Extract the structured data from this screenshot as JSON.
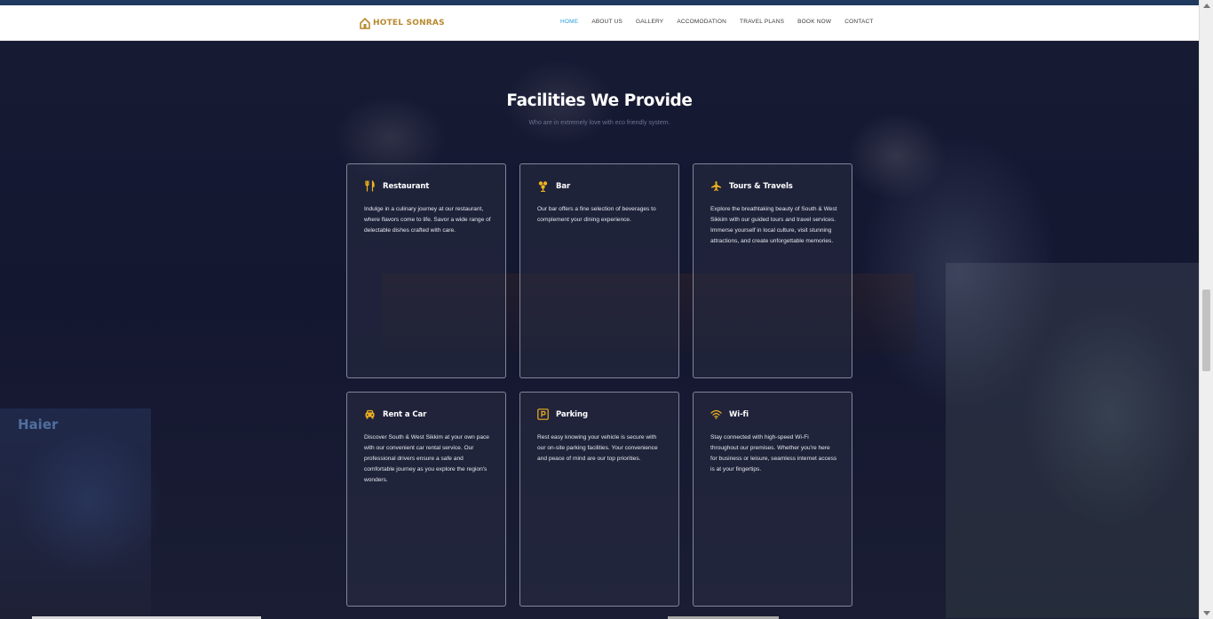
{
  "navbar": {
    "logo_text": "HOTEL SONRAS",
    "menu": [
      {
        "label": "HOME",
        "active": true
      },
      {
        "label": "ABOUT US",
        "active": false
      },
      {
        "label": "GALLERY",
        "active": false
      },
      {
        "label": "ACCOMODATION",
        "active": false
      },
      {
        "label": "TRAVEL PLANS",
        "active": false
      },
      {
        "label": "BOOK NOW",
        "active": false
      },
      {
        "label": "CONTACT",
        "active": false
      }
    ]
  },
  "section": {
    "title": "Facilities We Provide",
    "subtitle": "Who are in extremely love with eco friendly system.",
    "background_text": "Haier"
  },
  "facilities": [
    {
      "icon": "utensils-icon",
      "title": "Restaurant",
      "text": "Indulge in a culinary journey at our restaurant, where flavors come to life. Savor a wide range of delectable dishes crafted with care."
    },
    {
      "icon": "cocktail-icon",
      "title": "Bar",
      "text": "Our bar offers a fine selection of beverages to complement your dining experience."
    },
    {
      "icon": "airplane-icon",
      "title": "Tours & Travels",
      "text": "Explore the breathtaking beauty of South & West Sikkim with our guided tours and travel services. Immerse yourself in local culture, visit stunning attractions, and create unforgettable memories."
    },
    {
      "icon": "car-icon",
      "title": "Rent a Car",
      "text": "Discover South & West Sikkim at your own pace with our convenient car rental service. Our professional drivers ensure a safe and comfortable journey as you explore the region's wonders."
    },
    {
      "icon": "parking-icon",
      "title": "Parking",
      "text": "Rest easy knowing your vehicle is secure with our on-site parking facilities. Your convenience and peace of mind are our top priorities."
    },
    {
      "icon": "wifi-icon",
      "title": "Wi-fi",
      "text": "Stay connected with high-speed Wi-Fi throughout our premises. Whether you're here for business or leisure, seamless internet access is at your fingertips."
    }
  ],
  "colors": {
    "accent": "#f0b21e",
    "nav_active": "#2a9ee0",
    "logo": "#b8892f",
    "background": "#141730"
  }
}
